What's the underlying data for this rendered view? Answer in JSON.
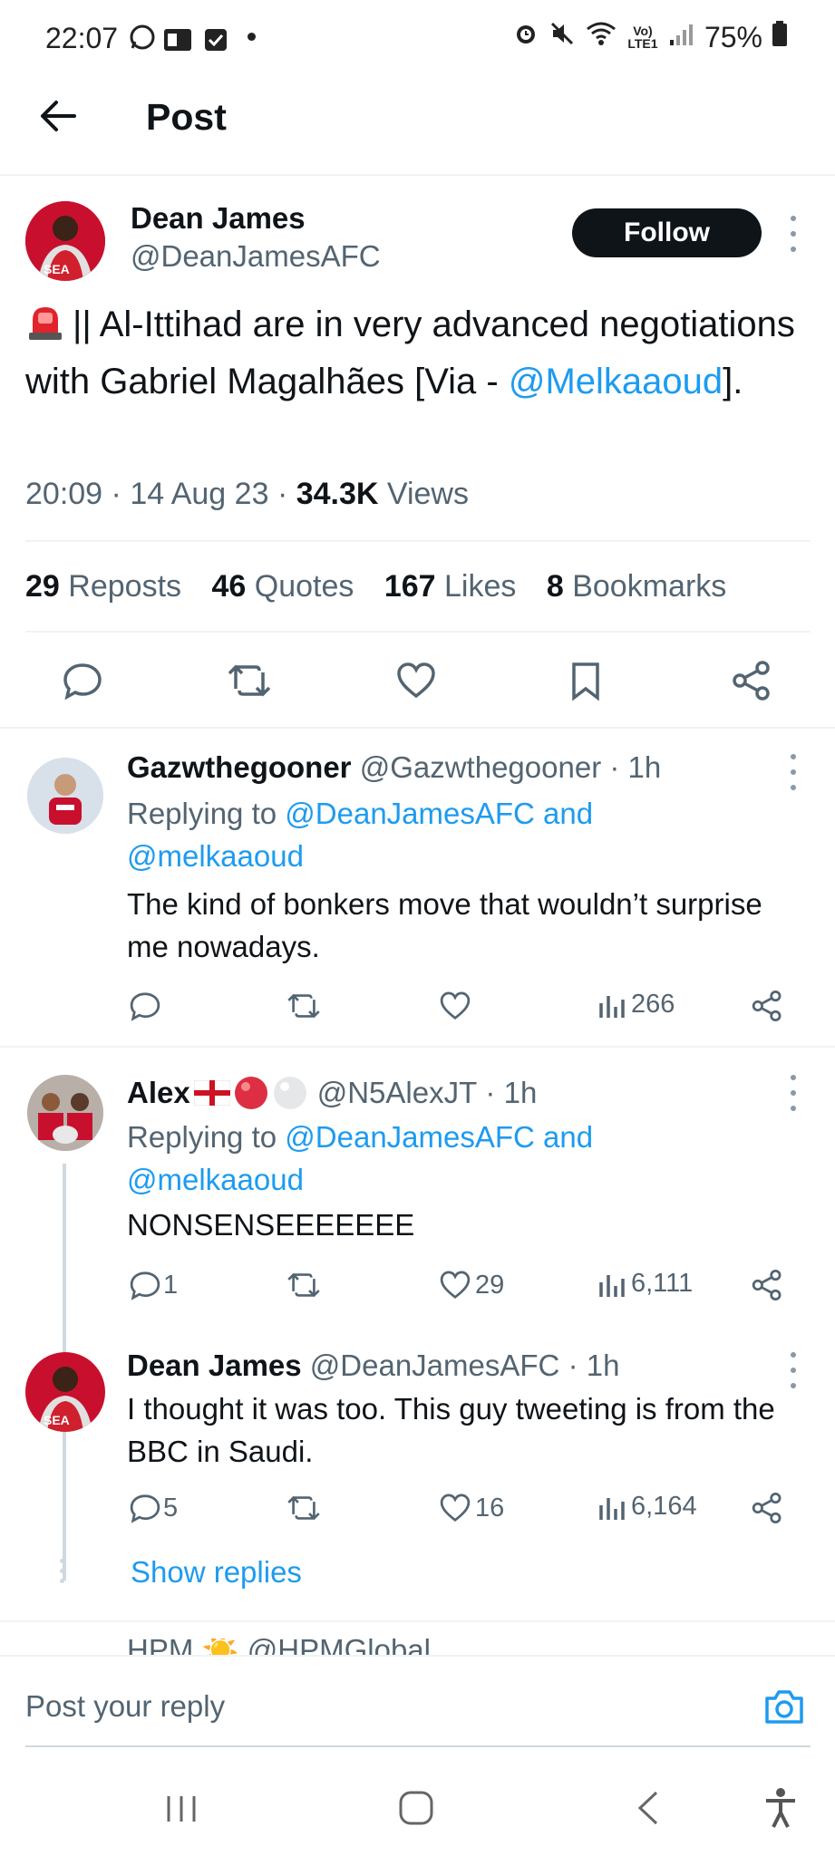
{
  "status_bar": {
    "time": "22:07",
    "battery": "75%",
    "network": "Vo) LTE1"
  },
  "header": {
    "title": "Post"
  },
  "post": {
    "author_name": "Dean James",
    "author_handle": "@DeanJamesAFC",
    "follow_label": "Follow",
    "text_part1": "|| Al-Ittihad are in very advanced negotiations with Gabriel Magalhães [Via - ",
    "mention": "@Melkaaoud",
    "text_part2": "].",
    "time": "20:09",
    "date": "14 Aug 23",
    "views_count": "34.3K",
    "views_label": "Views",
    "reposts_count": "29",
    "reposts_label": "Reposts",
    "quotes_count": "46",
    "quotes_label": "Quotes",
    "likes_count": "167",
    "likes_label": "Likes",
    "bookmarks_count": "8",
    "bookmarks_label": "Bookmarks"
  },
  "replies": [
    {
      "name": "Gazwthegooner",
      "handle": "@Gazwthegooner",
      "time": "1h",
      "replying_label": "Replying to",
      "replying_to": "@DeanJamesAFC and",
      "replying_to2": "@melkaaoud",
      "text": "The kind of bonkers move that wouldn’t surprise me nowadays.",
      "replies": "",
      "likes": "",
      "views": "266"
    },
    {
      "name": "Alex",
      "handle": "@N5AlexJT",
      "time": "1h",
      "replying_label": "Replying to",
      "replying_to": "@DeanJamesAFC and",
      "replying_to2": "@melkaaoud",
      "text": "NONSENSEEEEEEE",
      "replies": "1",
      "likes": "29",
      "views": "6,111"
    },
    {
      "name": "Dean James",
      "handle": "@DeanJamesAFC",
      "time": "1h",
      "text": "I thought it was too. This guy tweeting is from the BBC in Saudi.",
      "replies": "5",
      "likes": "16",
      "views": "6,164"
    }
  ],
  "show_replies_label": "Show replies",
  "partial_next": "HPM ☀️ @HPMGlobal",
  "composer": {
    "placeholder": "Post your reply"
  },
  "colors": {
    "accent": "#1d9bf0",
    "text": "#0f1419",
    "muted": "#536471"
  }
}
